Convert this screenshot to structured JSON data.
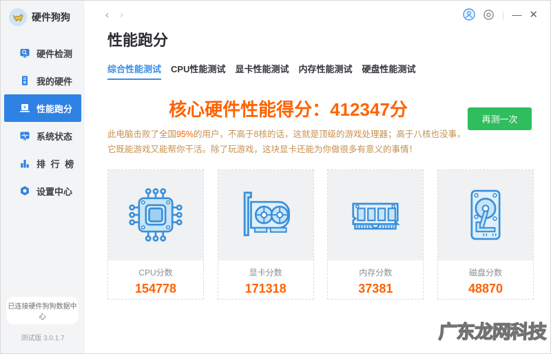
{
  "app": {
    "name": "硬件狗狗",
    "connection_status": "已连接硬件狗狗数据中心",
    "version": "测试版 3.0.1.7"
  },
  "topbar": {
    "back": "‹",
    "forward": "›",
    "minimize": "—",
    "close": "✕",
    "divider": "|"
  },
  "sidebar": {
    "items": [
      {
        "label": "硬件检测",
        "icon": "detect-icon"
      },
      {
        "label": "我的硬件",
        "icon": "my-hardware-icon"
      },
      {
        "label": "性能跑分",
        "icon": "benchmark-icon",
        "active": true
      },
      {
        "label": "系统状态",
        "icon": "system-status-icon"
      },
      {
        "label": "排 行 榜",
        "icon": "ranking-icon"
      },
      {
        "label": "设置中心",
        "icon": "settings-icon"
      }
    ]
  },
  "page": {
    "title": "性能跑分",
    "tabs": [
      {
        "label": "综合性能测试",
        "active": true
      },
      {
        "label": "CPU性能测试"
      },
      {
        "label": "显卡性能测试"
      },
      {
        "label": "内存性能测试"
      },
      {
        "label": "硬盘性能测试"
      }
    ]
  },
  "score": {
    "headline": "核心硬件性能得分：412347分",
    "retest_button": "再测一次",
    "description_before": "此电脑击败了全国",
    "description_highlight": "95%",
    "description_after": "的用户，不高于8核的话，这就是顶级的游戏处理器；高于八核也没事，它既能游戏又能帮你干活。除了玩游戏，这块显卡还能为你做很多有意义的事情！"
  },
  "cards": [
    {
      "label": "CPU分数",
      "value": "154778",
      "icon": "cpu-icon"
    },
    {
      "label": "显卡分数",
      "value": "171318",
      "icon": "gpu-icon"
    },
    {
      "label": "内存分数",
      "value": "37381",
      "icon": "ram-icon"
    },
    {
      "label": "磁盘分数",
      "value": "48870",
      "icon": "hdd-icon"
    }
  ],
  "watermark": "广东龙网科技",
  "colors": {
    "accent_blue": "#2e82e4",
    "active_tab_blue": "#3a8ee6",
    "score_orange": "#ff6200",
    "button_green": "#2fbd5d",
    "description_tan": "#c6914f",
    "sidebar_bg": "#f3f4f6",
    "card_art_bg": "#f0f1f3"
  }
}
